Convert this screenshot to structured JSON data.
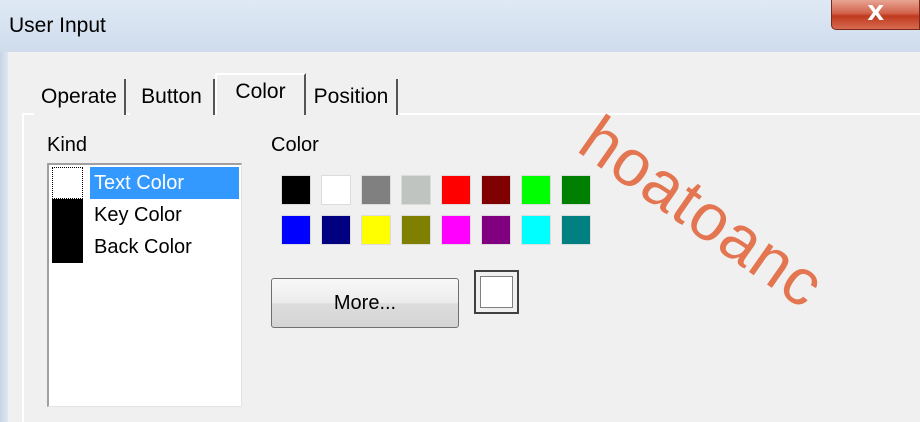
{
  "window": {
    "title": "User Input",
    "close_label": "X"
  },
  "tabs": [
    {
      "label": "Operate",
      "active": false
    },
    {
      "label": "Button",
      "active": false
    },
    {
      "label": "Color",
      "active": true
    },
    {
      "label": "Position",
      "active": false
    }
  ],
  "kind": {
    "heading": "Kind",
    "items": [
      {
        "label": "Text Color",
        "swatch": "#ffffff",
        "selected": true
      },
      {
        "label": "Key Color",
        "swatch": "#000000",
        "selected": false
      },
      {
        "label": "Back Color",
        "swatch": "#000000",
        "selected": false
      }
    ]
  },
  "color": {
    "heading": "Color",
    "palette_rows": [
      [
        "#000000",
        "#ffffff",
        "#808080",
        "#c0c4c0",
        "#ff0000",
        "#800000",
        "#00ff00",
        "#008000"
      ],
      [
        "#0000ff",
        "#000080",
        "#ffff00",
        "#808000",
        "#ff00ff",
        "#800080",
        "#00ffff",
        "#008080"
      ]
    ],
    "more_label": "More...",
    "preview_color": "#ffffff"
  },
  "watermark": "hoatoanc"
}
